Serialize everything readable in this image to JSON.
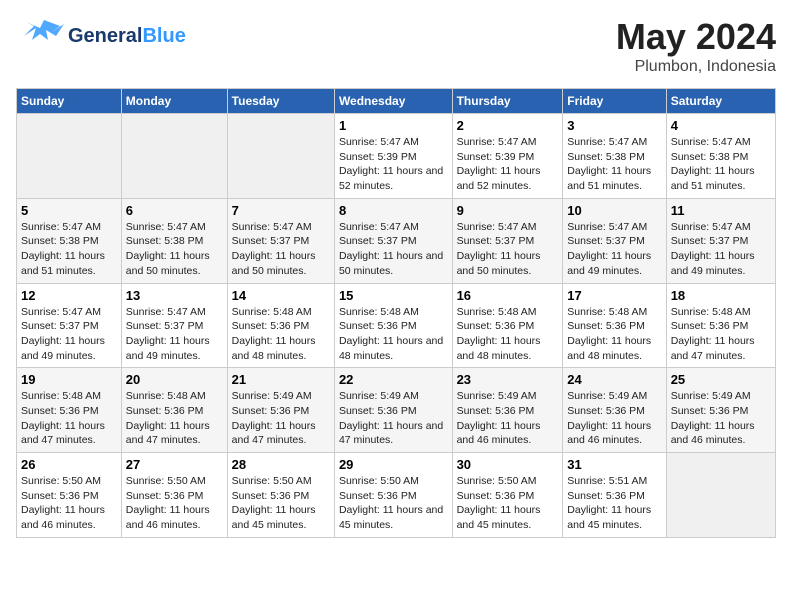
{
  "logo": {
    "text_general": "General",
    "text_blue": "Blue"
  },
  "header": {
    "title": "May 2024",
    "subtitle": "Plumbon, Indonesia"
  },
  "days_of_week": [
    "Sunday",
    "Monday",
    "Tuesday",
    "Wednesday",
    "Thursday",
    "Friday",
    "Saturday"
  ],
  "weeks": [
    [
      {
        "day": "",
        "empty": true
      },
      {
        "day": "",
        "empty": true
      },
      {
        "day": "",
        "empty": true
      },
      {
        "day": "1",
        "sunrise": "5:47 AM",
        "sunset": "5:39 PM",
        "daylight": "11 hours and 52 minutes."
      },
      {
        "day": "2",
        "sunrise": "5:47 AM",
        "sunset": "5:39 PM",
        "daylight": "11 hours and 52 minutes."
      },
      {
        "day": "3",
        "sunrise": "5:47 AM",
        "sunset": "5:38 PM",
        "daylight": "11 hours and 51 minutes."
      },
      {
        "day": "4",
        "sunrise": "5:47 AM",
        "sunset": "5:38 PM",
        "daylight": "11 hours and 51 minutes."
      }
    ],
    [
      {
        "day": "5",
        "sunrise": "5:47 AM",
        "sunset": "5:38 PM",
        "daylight": "11 hours and 51 minutes."
      },
      {
        "day": "6",
        "sunrise": "5:47 AM",
        "sunset": "5:38 PM",
        "daylight": "11 hours and 50 minutes."
      },
      {
        "day": "7",
        "sunrise": "5:47 AM",
        "sunset": "5:37 PM",
        "daylight": "11 hours and 50 minutes."
      },
      {
        "day": "8",
        "sunrise": "5:47 AM",
        "sunset": "5:37 PM",
        "daylight": "11 hours and 50 minutes."
      },
      {
        "day": "9",
        "sunrise": "5:47 AM",
        "sunset": "5:37 PM",
        "daylight": "11 hours and 50 minutes."
      },
      {
        "day": "10",
        "sunrise": "5:47 AM",
        "sunset": "5:37 PM",
        "daylight": "11 hours and 49 minutes."
      },
      {
        "day": "11",
        "sunrise": "5:47 AM",
        "sunset": "5:37 PM",
        "daylight": "11 hours and 49 minutes."
      }
    ],
    [
      {
        "day": "12",
        "sunrise": "5:47 AM",
        "sunset": "5:37 PM",
        "daylight": "11 hours and 49 minutes."
      },
      {
        "day": "13",
        "sunrise": "5:47 AM",
        "sunset": "5:37 PM",
        "daylight": "11 hours and 49 minutes."
      },
      {
        "day": "14",
        "sunrise": "5:48 AM",
        "sunset": "5:36 PM",
        "daylight": "11 hours and 48 minutes."
      },
      {
        "day": "15",
        "sunrise": "5:48 AM",
        "sunset": "5:36 PM",
        "daylight": "11 hours and 48 minutes."
      },
      {
        "day": "16",
        "sunrise": "5:48 AM",
        "sunset": "5:36 PM",
        "daylight": "11 hours and 48 minutes."
      },
      {
        "day": "17",
        "sunrise": "5:48 AM",
        "sunset": "5:36 PM",
        "daylight": "11 hours and 48 minutes."
      },
      {
        "day": "18",
        "sunrise": "5:48 AM",
        "sunset": "5:36 PM",
        "daylight": "11 hours and 47 minutes."
      }
    ],
    [
      {
        "day": "19",
        "sunrise": "5:48 AM",
        "sunset": "5:36 PM",
        "daylight": "11 hours and 47 minutes."
      },
      {
        "day": "20",
        "sunrise": "5:48 AM",
        "sunset": "5:36 PM",
        "daylight": "11 hours and 47 minutes."
      },
      {
        "day": "21",
        "sunrise": "5:49 AM",
        "sunset": "5:36 PM",
        "daylight": "11 hours and 47 minutes."
      },
      {
        "day": "22",
        "sunrise": "5:49 AM",
        "sunset": "5:36 PM",
        "daylight": "11 hours and 47 minutes."
      },
      {
        "day": "23",
        "sunrise": "5:49 AM",
        "sunset": "5:36 PM",
        "daylight": "11 hours and 46 minutes."
      },
      {
        "day": "24",
        "sunrise": "5:49 AM",
        "sunset": "5:36 PM",
        "daylight": "11 hours and 46 minutes."
      },
      {
        "day": "25",
        "sunrise": "5:49 AM",
        "sunset": "5:36 PM",
        "daylight": "11 hours and 46 minutes."
      }
    ],
    [
      {
        "day": "26",
        "sunrise": "5:50 AM",
        "sunset": "5:36 PM",
        "daylight": "11 hours and 46 minutes."
      },
      {
        "day": "27",
        "sunrise": "5:50 AM",
        "sunset": "5:36 PM",
        "daylight": "11 hours and 46 minutes."
      },
      {
        "day": "28",
        "sunrise": "5:50 AM",
        "sunset": "5:36 PM",
        "daylight": "11 hours and 45 minutes."
      },
      {
        "day": "29",
        "sunrise": "5:50 AM",
        "sunset": "5:36 PM",
        "daylight": "11 hours and 45 minutes."
      },
      {
        "day": "30",
        "sunrise": "5:50 AM",
        "sunset": "5:36 PM",
        "daylight": "11 hours and 45 minutes."
      },
      {
        "day": "31",
        "sunrise": "5:51 AM",
        "sunset": "5:36 PM",
        "daylight": "11 hours and 45 minutes."
      },
      {
        "day": "",
        "empty": true
      }
    ]
  ],
  "labels": {
    "sunrise": "Sunrise:",
    "sunset": "Sunset:",
    "daylight": "Daylight:"
  }
}
